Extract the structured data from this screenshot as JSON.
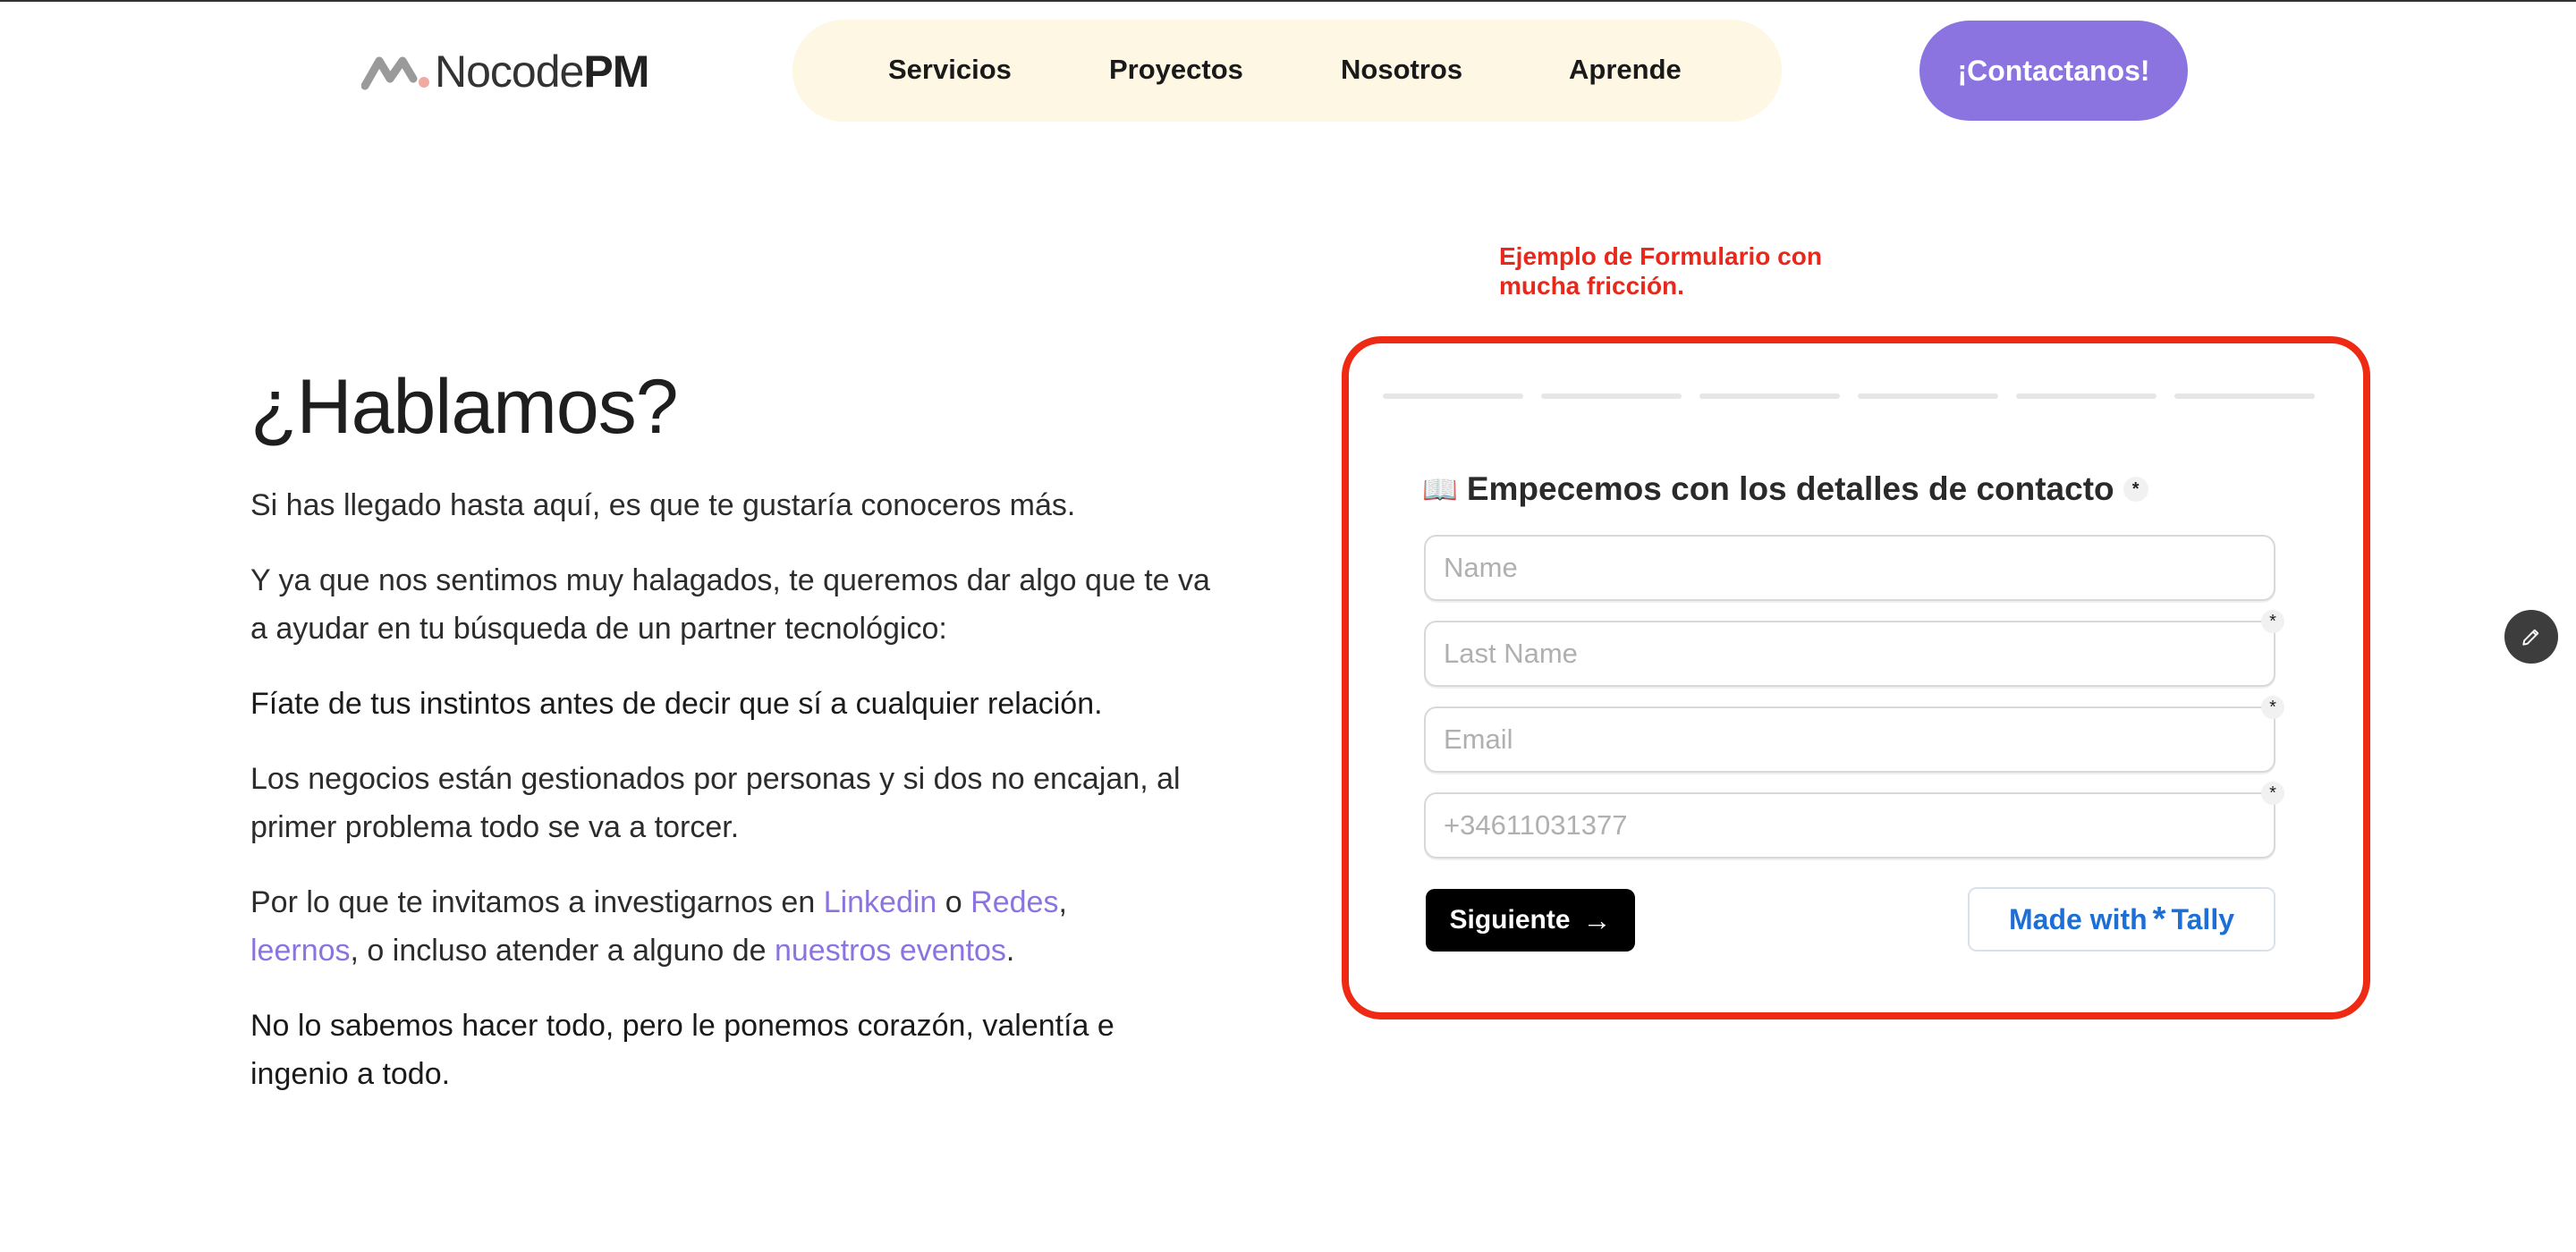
{
  "brand": {
    "name_light": "Nocode",
    "name_bold": "PM"
  },
  "nav": {
    "items": [
      {
        "label": "Servicios"
      },
      {
        "label": "Proyectos"
      },
      {
        "label": "Nosotros"
      },
      {
        "label": "Aprende"
      }
    ],
    "cta_label": "¡Contactanos!"
  },
  "hero": {
    "title": "¿Hablamos?",
    "p1": "Si has llegado hasta aquí, es que te gustaría conoceros más.",
    "p2": "Y ya que nos sentimos muy halagados, te queremos dar algo que te va a ayudar en tu búsqueda de un partner tecnológico:",
    "p3": "Fíate de tus instintos antes de decir que sí a cualquier relación.",
    "p4": "Los negocios están gestionados por personas y si dos no encajan, al primer problema todo se va a torcer.",
    "p5": {
      "prefix": "Por lo que te invitamos a investigarnos en ",
      "link1": "Linkedin",
      "sep1": " o ",
      "link2": "Redes",
      "sep2": ",",
      "link3": "leernos",
      "mid": ", o incluso atender a alguno de ",
      "link4": "nuestros eventos",
      "suffix": "."
    },
    "p6": "No lo sabemos hacer todo, pero le ponemos corazón, valentía e ingenio a todo."
  },
  "annotation": "Ejemplo de Formulario con mucha fricción.",
  "form": {
    "progress_segments": 6,
    "question_icon": "📖",
    "question": "Empecemos con los detalles de contacto",
    "required_mark": "*",
    "fields": [
      {
        "placeholder": "Name",
        "value": ""
      },
      {
        "placeholder": "Last Name",
        "value": ""
      },
      {
        "placeholder": "Email",
        "value": ""
      },
      {
        "placeholder": "+34611031377",
        "value": ""
      }
    ],
    "next_label": "Siguiente",
    "next_icon": "arrow-right-icon",
    "badge": {
      "prefix": "Made with",
      "icon": "tally-asterisk-icon",
      "brand": "Tally"
    }
  },
  "colors": {
    "accent": "#8b73e0",
    "nav_bg": "#fdf7e3",
    "annotation": "#e8281b",
    "card_border": "#ee2a14",
    "tally_blue": "#1d6fd6"
  },
  "fab_icon": "pencil-icon"
}
